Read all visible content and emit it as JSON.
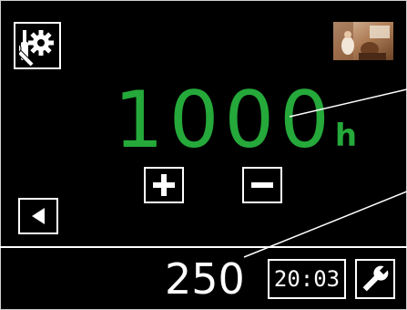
{
  "counter": {
    "value": "1000",
    "unit": "h"
  },
  "status_bar": {
    "value": "250",
    "time": "20:03"
  },
  "icons": {
    "settings": "gear-wrench-screwdriver-icon",
    "plus": "plus-icon",
    "minus": "minus-icon",
    "back": "triangle-left-icon",
    "service": "wrench-icon"
  },
  "colors": {
    "value_green": "#25a93a",
    "background": "#000000",
    "foreground": "#ffffff"
  }
}
